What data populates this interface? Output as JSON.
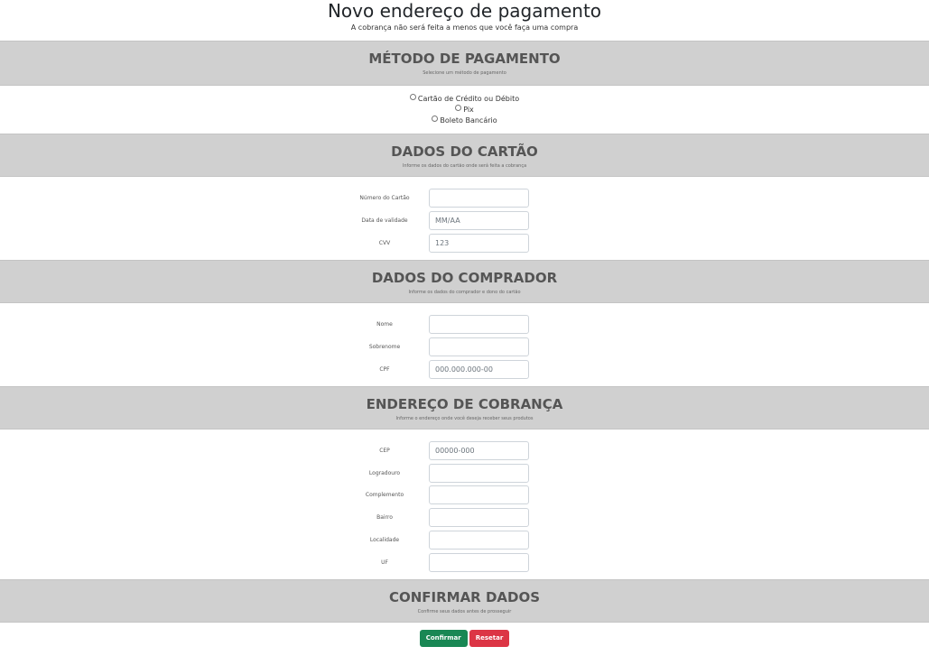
{
  "page": {
    "title": "Novo endereço de pagamento",
    "subtitle": "A cobrança não será feita a menos que você faça uma compra"
  },
  "sections": {
    "payment_method": {
      "title": "MÉTODO DE PAGAMENTO",
      "description": "Selecione um método de pagamento",
      "options": [
        "Cartão de Crédito ou Débito",
        "Pix",
        "Boleto Bancário"
      ]
    },
    "card": {
      "title": "DADOS DO CARTÃO",
      "description": "Informe os dados do cartão onde será feita a cobrança",
      "fields": [
        {
          "label": "Número do Cartão",
          "value": "",
          "placeholder": ""
        },
        {
          "label": "Data de validade",
          "value": "",
          "placeholder": "MM/AA"
        },
        {
          "label": "CVV",
          "value": "",
          "placeholder": "123"
        }
      ]
    },
    "buyer": {
      "title": "DADOS DO COMPRADOR",
      "description": "Informe os dados do comprador e dono do cartão",
      "fields": [
        {
          "label": "Nome",
          "value": "",
          "placeholder": ""
        },
        {
          "label": "Sobrenome",
          "value": "",
          "placeholder": ""
        },
        {
          "label": "CPF",
          "value": "",
          "placeholder": "000.000.000-00"
        }
      ]
    },
    "billing_address": {
      "title": "ENDEREÇO DE COBRANÇA",
      "description": "Informe o endereço onde você deseja receber seus produtos",
      "fields": [
        {
          "label": "CEP",
          "value": "",
          "placeholder": "00000-000"
        },
        {
          "label": "Logradouro",
          "value": "",
          "placeholder": ""
        },
        {
          "label": "Complemento",
          "value": "",
          "placeholder": ""
        },
        {
          "label": "Bairro",
          "value": "",
          "placeholder": ""
        },
        {
          "label": "Localidade",
          "value": "",
          "placeholder": ""
        },
        {
          "label": "UF",
          "value": "",
          "placeholder": ""
        }
      ]
    },
    "confirm": {
      "title": "CONFIRMAR DADOS",
      "description": "Confirme seus dados antes de prosseguir",
      "confirm_label": "Confirmar",
      "reset_label": "Resetar"
    }
  },
  "colors": {
    "section_bg": "#d0d0d0",
    "confirm_button": "#198754",
    "reset_button": "#dc3545"
  }
}
